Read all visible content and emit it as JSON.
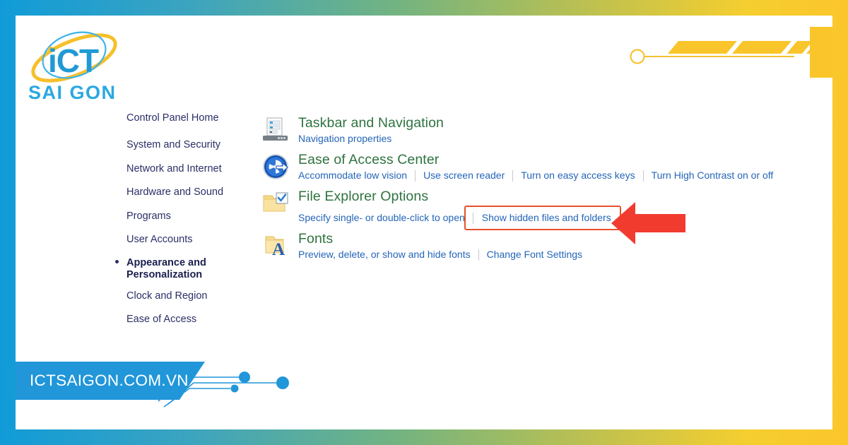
{
  "brand": {
    "logo_primary": "iCT",
    "logo_secondary": "SAI GON",
    "footer_url": "ICTSAIGON.COM.VN",
    "blue": "#1596D8",
    "yellow": "#FBC62B",
    "logo_blue": "#2AA8E0",
    "logo_text_blue": "#1F8FD6"
  },
  "border": {
    "gradient_start": "#109BD8",
    "gradient_end": "#FBC62B"
  },
  "sidebar": {
    "items": [
      {
        "label": "Control Panel Home",
        "current": false
      },
      {
        "label": "System and Security",
        "current": false
      },
      {
        "label": "Network and Internet",
        "current": false
      },
      {
        "label": "Hardware and Sound",
        "current": false
      },
      {
        "label": "Programs",
        "current": false
      },
      {
        "label": "User Accounts",
        "current": false
      },
      {
        "label": "Appearance and Personalization",
        "current": true
      },
      {
        "label": "Clock and Region",
        "current": false
      },
      {
        "label": "Ease of Access",
        "current": false
      }
    ]
  },
  "main": {
    "heading_color": "#2F7340",
    "link_color": "#2465B8",
    "rows": [
      {
        "icon": "taskbar-monitor-icon",
        "title": "Taskbar and Navigation",
        "links": [
          "Navigation properties"
        ]
      },
      {
        "icon": "ease-of-access-icon",
        "title": "Ease of Access Center",
        "links": [
          "Accommodate low vision",
          "Use screen reader",
          "Turn on easy access keys",
          "Turn High Contrast on or off"
        ]
      },
      {
        "icon": "file-explorer-folder-check-icon",
        "title": "File Explorer Options",
        "links": [
          "Specify single- or double-click to open",
          "Show hidden files and folders"
        ],
        "highlighted_link": "Show hidden files and folders"
      },
      {
        "icon": "fonts-folder-icon",
        "title": "Fonts",
        "links": [
          "Preview, delete, or show and hide fonts",
          "Change Font Settings"
        ]
      }
    ]
  },
  "annotation": {
    "highlight_box_color": "#E8502A",
    "arrow_color": "#F23B2F",
    "arrow_direction": "left",
    "target_label": "Show hidden files and folders"
  }
}
